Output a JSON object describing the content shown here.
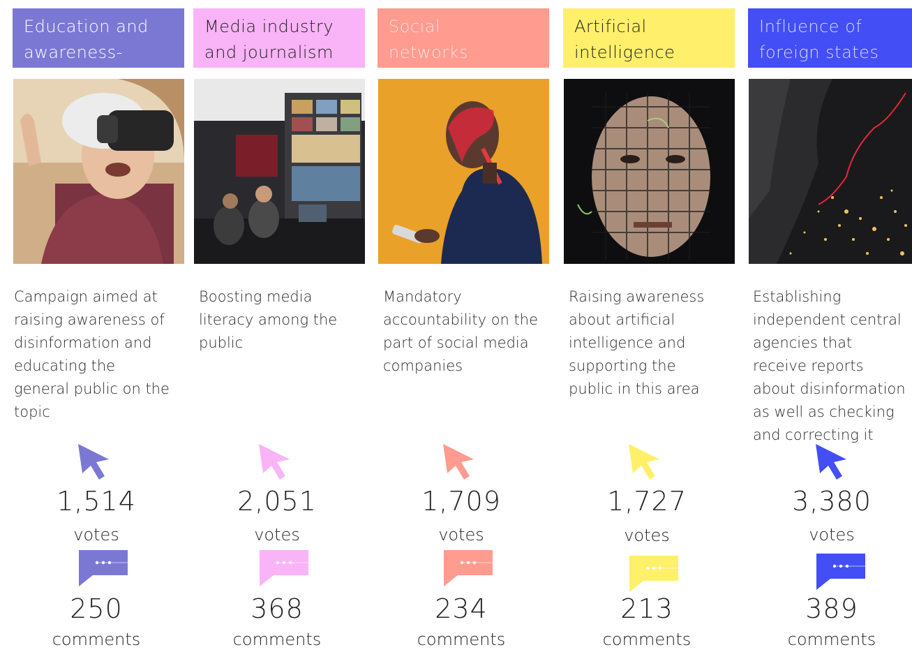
{
  "cards": [
    {
      "title_line1": "Education and",
      "title_line2": "awareness-",
      "header_color": "#7b78d4",
      "header_text_color": "#ffffff",
      "image_alt": "elderly woman wearing VR headset",
      "desc_lines": [
        "Campaign aimed at",
        "raising awareness of",
        "disinformation and",
        "educating the",
        "general public on the",
        "topic"
      ],
      "votes": "1,514",
      "votes_label": "votes",
      "comments": "250",
      "comments_label": "comments",
      "icon_color": "#7b78d4"
    },
    {
      "title_line1": "Media industry",
      "title_line2": "and journalism",
      "header_color": "#f9b3f7",
      "header_text_color": "#222222",
      "image_alt": "newsroom control room with monitors",
      "desc_lines": [
        "Boosting media",
        "literacy among the",
        "public"
      ],
      "votes": "2,051",
      "votes_label": "votes",
      "comments": "368",
      "comments_label": "comments",
      "icon_color": "#f9b3f7"
    },
    {
      "title_line1": "Social",
      "title_line2": "networks",
      "header_color": "#ff9b8f",
      "header_text_color": "#ffe0dc",
      "image_alt": "man looking at smartphone on orange background",
      "desc_lines": [
        "Mandatory",
        "accountability on the",
        "part of social media",
        "companies"
      ],
      "votes": "1,709",
      "votes_label": "votes",
      "comments": "234",
      "comments_label": "comments",
      "icon_color": "#ff9b8f"
    },
    {
      "title_line1": "Artificial",
      "title_line2": "intelligence",
      "header_color": "#ffef6b",
      "header_text_color": "#222222",
      "image_alt": "fragmented portrait of a face",
      "desc_lines": [
        "Raising awareness",
        "about artificial",
        "intelligence and",
        "supporting the",
        "public in this area"
      ],
      "votes": "1,727",
      "votes_label": "votes",
      "comments": "213",
      "comments_label": "comments",
      "icon_color": "#fff06a"
    },
    {
      "title_line1": "Influence of",
      "title_line2": "foreign states",
      "header_color": "#434ef5",
      "header_text_color": "#d8dbff",
      "image_alt": "satellite night view of city lights with red line",
      "desc_lines": [
        "Establishing",
        "independent central",
        "agencies that",
        "receive reports",
        "about disinformation",
        "as well as checking",
        "and correcting it"
      ],
      "votes": "3,380",
      "votes_label": "votes",
      "comments": "389",
      "comments_label": "comments",
      "icon_color": "#434ef5"
    }
  ]
}
